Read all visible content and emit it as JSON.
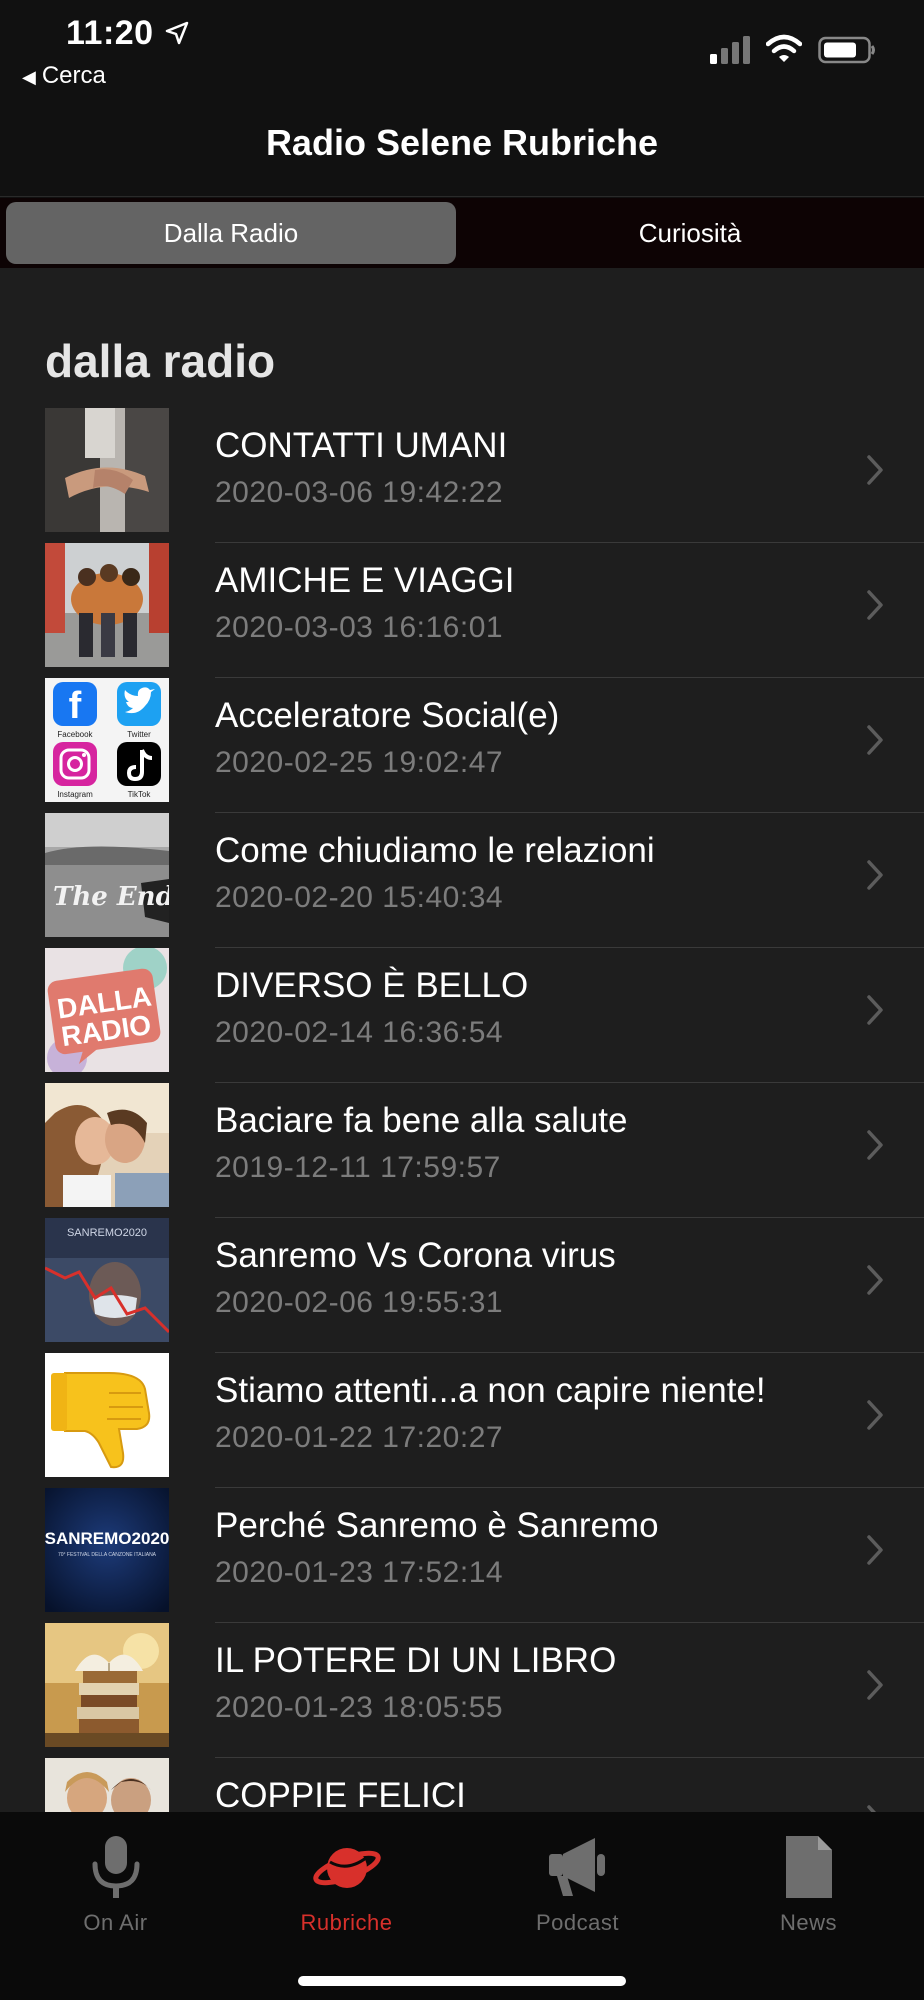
{
  "status_bar": {
    "time": "11:20",
    "back_label": "Cerca"
  },
  "nav": {
    "title": "Radio Selene Rubriche"
  },
  "segments": [
    {
      "label": "Dalla Radio",
      "selected": true
    },
    {
      "label": "Curiosità",
      "selected": false
    }
  ],
  "section": {
    "title": "dalla radio"
  },
  "items": [
    {
      "title": "CONTATTI UMANI",
      "date": "2020-03-06 19:42:22"
    },
    {
      "title": "AMICHE E VIAGGI",
      "date": "2020-03-03 16:16:01"
    },
    {
      "title": "Acceleratore Social(e)",
      "date": "2020-02-25 19:02:47"
    },
    {
      "title": "Come chiudiamo le relazioni",
      "date": "2020-02-20 15:40:34"
    },
    {
      "title": "DIVERSO È BELLO",
      "date": "2020-02-14 16:36:54"
    },
    {
      "title": "Baciare fa bene alla salute",
      "date": "2019-12-11 17:59:57"
    },
    {
      "title": "Sanremo Vs Corona virus",
      "date": "2020-02-06 19:55:31"
    },
    {
      "title": "Stiamo attenti...a non capire niente!",
      "date": "2020-01-22 17:20:27"
    },
    {
      "title": "Perché Sanremo è Sanremo",
      "date": "2020-01-23 17:52:14"
    },
    {
      "title": "IL POTERE DI UN LIBRO",
      "date": "2020-01-23 18:05:55"
    },
    {
      "title": "COPPIE FELICI",
      "date": ""
    }
  ],
  "thumbnail_text": {
    "social": [
      "Facebook",
      "Twitter",
      "Instagram",
      "TikTok"
    ],
    "the_end": "The End",
    "dalla_radio": [
      "DALLA",
      "RADIO"
    ],
    "sanremo_small": "SANREMO2020",
    "sanremo_big": "SANREMO2020",
    "sanremo_sub": "70° FESTIVAL DELLA CANZONE ITALIANA"
  },
  "tabs": [
    {
      "label": "On Air",
      "icon": "microphone-icon",
      "active": false
    },
    {
      "label": "Rubriche",
      "icon": "planet-icon",
      "active": true
    },
    {
      "label": "Podcast",
      "icon": "megaphone-icon",
      "active": false
    },
    {
      "label": "News",
      "icon": "document-icon",
      "active": false
    }
  ],
  "colors": {
    "accent": "#d8302b",
    "background": "#111111",
    "list_background": "#1e1e1e",
    "segment_selected": "#646464",
    "secondary_text": "#7c7c7c",
    "tab_inactive": "#6e6e6e"
  }
}
